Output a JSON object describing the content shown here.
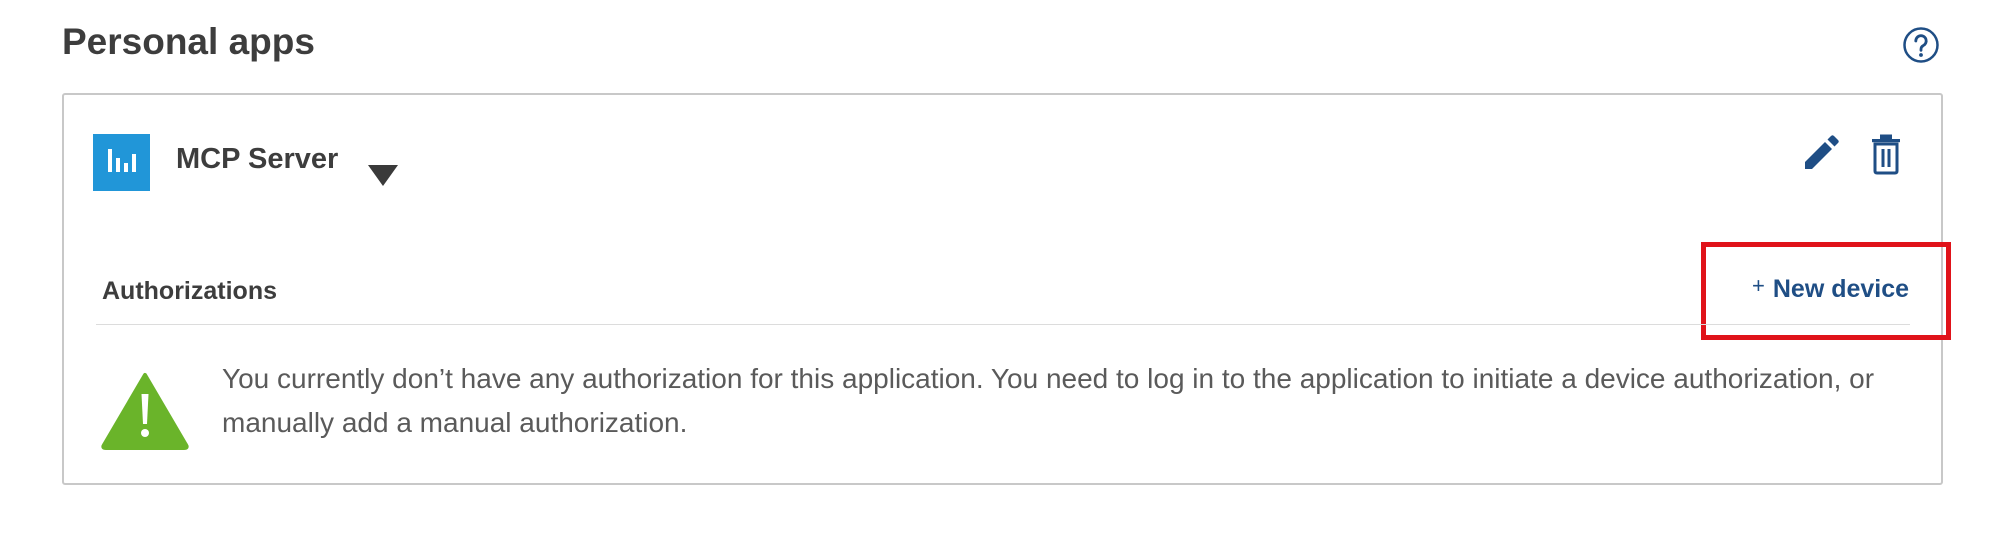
{
  "page": {
    "title": "Personal apps"
  },
  "header": {
    "help_icon": "question-circle-icon"
  },
  "app_card": {
    "name": "MCP Server",
    "logo_icon": "bar-chart-icon",
    "dropdown_icon": "caret-down-icon",
    "edit_icon": "pencil-icon",
    "delete_icon": "trash-icon",
    "authorizations": {
      "heading": "Authorizations",
      "new_device": {
        "plus": "+",
        "label": "New device"
      },
      "warning_icon": "warning-triangle-icon",
      "empty_message": "You currently don’t have any authorization for this application. You need to log in to the application to initiate a device authorization, or manually add a manual authorization."
    }
  },
  "colors": {
    "accent": "#1f4e85",
    "logo_bg": "#2196d8",
    "warning": "#6ab42a",
    "highlight": "#e0131a",
    "border": "#c8c8c8"
  }
}
